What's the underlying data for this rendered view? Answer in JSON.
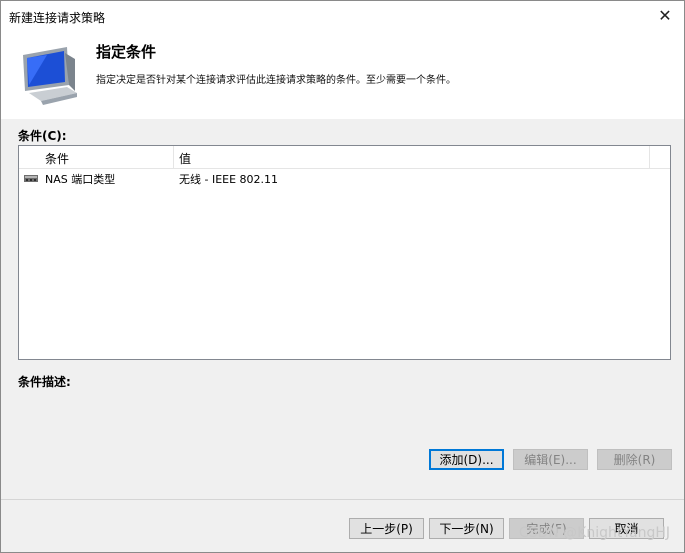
{
  "window": {
    "title": "新建连接请求策略",
    "close_glyph": "✕"
  },
  "header": {
    "title": "指定条件",
    "description": "指定决定是否针对某个连接请求评估此连接请求策略的条件。至少需要一个条件。",
    "icon": "monitor-icon"
  },
  "conditions": {
    "label": "条件(C):",
    "columns": [
      "条件",
      "值"
    ],
    "rows": [
      {
        "icon": "network-port-icon",
        "condition": "NAS 端口类型",
        "value": "无线 - IEEE 802.11"
      }
    ]
  },
  "description_section": {
    "label": "条件描述:"
  },
  "buttons": {
    "add": "添加(D)...",
    "edit": "编辑(E)...",
    "delete": "删除(R)",
    "back": "上一步(P)",
    "next": "下一步(N)",
    "finish": "完成(F)",
    "cancel": "取消"
  },
  "watermark": "CSDN @KnightYangHJ",
  "colors": {
    "accent": "#0078d7",
    "icon_blue": "#1c4fd6"
  }
}
